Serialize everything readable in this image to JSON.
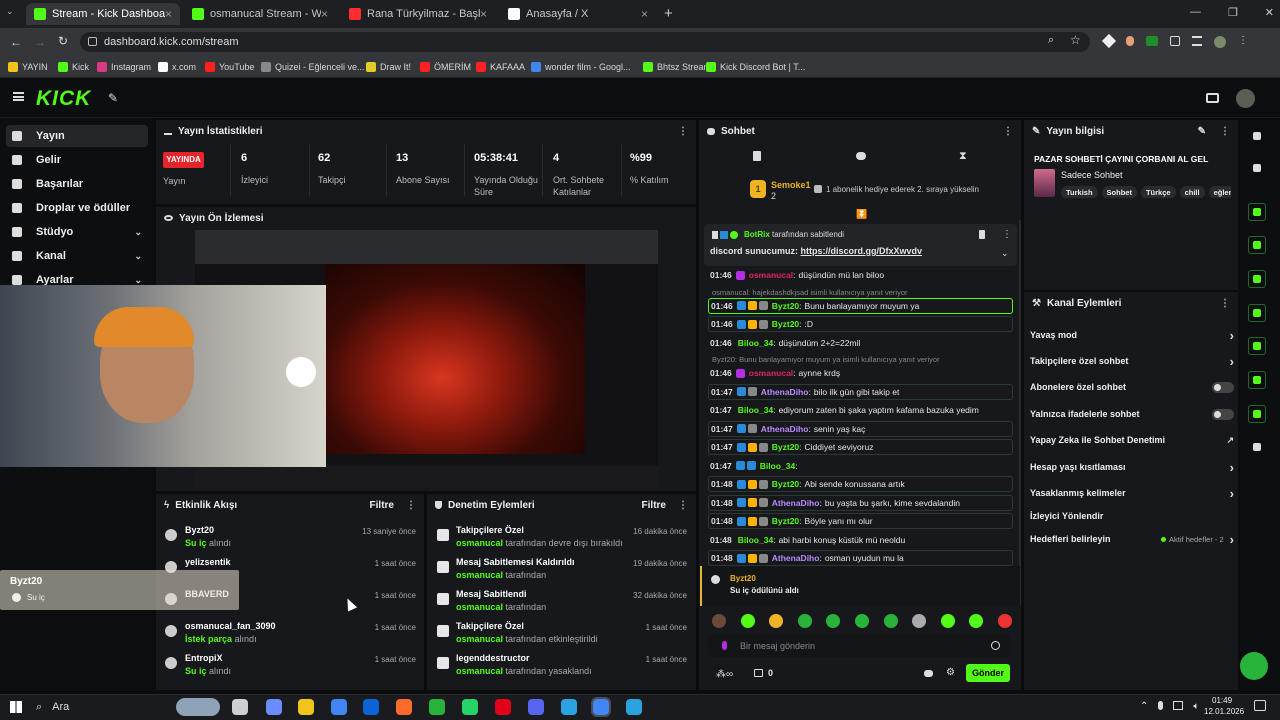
{
  "browser": {
    "tabs": [
      {
        "title": "Stream - Kick Dashboard",
        "color": "#53fc18"
      },
      {
        "title": "osmanucal Stream - Watch Live",
        "color": "#53fc18"
      },
      {
        "title": "Rana Türkyilmaz - Başka Hi",
        "color": "#ff2d2d"
      },
      {
        "title": "Anasayfa / X",
        "color": "#ffffff"
      }
    ],
    "url": "dashboard.kick.com/stream",
    "bookmarks": [
      "YAYIN",
      "Kick",
      "Instagram",
      "x.com",
      "YouTube",
      "Quizei - Eğlenceli ve...",
      "Draw It!",
      "ÖMERİM",
      "KAFAAA",
      "wonder film - Googl...",
      "Bhtsz Stream",
      "Kick Discord Bot | T..."
    ]
  },
  "kick": {
    "logo": "KICK",
    "sidebar": [
      {
        "label": "Yayın",
        "icon": "broadcast-icon",
        "chevron": false
      },
      {
        "label": "Gelir",
        "icon": "money-icon",
        "chevron": false
      },
      {
        "label": "Başarılar",
        "icon": "trophy-icon",
        "chevron": false
      },
      {
        "label": "Droplar ve ödüller",
        "icon": "gift-icon",
        "chevron": false
      },
      {
        "label": "Stüdyo",
        "icon": "video-icon",
        "chevron": true
      },
      {
        "label": "Kanal",
        "icon": "home-icon",
        "chevron": true
      },
      {
        "label": "Ayarlar",
        "icon": "gear-icon",
        "chevron": true
      }
    ]
  },
  "stats": {
    "title": "Yayın İstatistikleri",
    "live_badge": "YAYINDA",
    "live_label": "Yayın",
    "items": [
      {
        "value": "6",
        "label": "İzleyici"
      },
      {
        "value": "62",
        "label": "Takipçi"
      },
      {
        "value": "13",
        "label": "Abone Sayısı"
      },
      {
        "value": "05:38:41",
        "label": "Yayında Olduğu Süre"
      },
      {
        "value": "4",
        "label": "Ort. Sohbete Katılanlar"
      },
      {
        "value": "%99",
        "label": "% Katılım"
      }
    ]
  },
  "preview": {
    "title": "Yayın Ön İzlemesi"
  },
  "activity": {
    "title": "Etkinlik Akışı",
    "filter": "Filtre",
    "rows": [
      {
        "name": "Byzt20",
        "sub": "Su iç",
        "sub2": "alındı",
        "time": "13 saniye önce"
      },
      {
        "name": "yelizsentik",
        "sub": "",
        "sub2": "",
        "time": "1 saat önce"
      },
      {
        "name": "BBAVERD",
        "sub": "",
        "sub2": "",
        "time": "1 saat önce"
      },
      {
        "name": "osmanucal_fan_3090",
        "sub": "İstek parça",
        "sub2": "alındı",
        "time": "1 saat önce"
      },
      {
        "name": "EntropiX",
        "sub": "Su iç",
        "sub2": "alındı",
        "time": "1 saat önce"
      }
    ],
    "toast": {
      "name": "Byzt20",
      "sub": "Su iç"
    }
  },
  "moderation": {
    "title": "Denetim Eylemleri",
    "filter": "Filtre",
    "rows": [
      {
        "title": "Takipçilere Özel",
        "user": "osmanucal",
        "rest": "tarafından devre dışı bırakıldı",
        "time": "16 dakika önce",
        "icon": "heart-icon"
      },
      {
        "title": "Mesaj Sabitlemesi Kaldırıldı",
        "user": "osmanucal",
        "rest": "tarafından",
        "time": "19 dakika önce",
        "icon": "unpin-icon"
      },
      {
        "title": "Mesaj Sabitlendi",
        "user": "osmanucal",
        "rest": "tarafından",
        "time": "32 dakika önce",
        "icon": "pin-icon"
      },
      {
        "title": "Takipçilere Özel",
        "user": "osmanucal",
        "rest": "tarafından etkinleştirildi",
        "time": "1 saat önce",
        "icon": "heart-icon"
      },
      {
        "title": "legenddestructor",
        "user": "osmanucal",
        "rest": "tarafından yasaklandı",
        "time": "1 saat önce",
        "icon": "ban-icon"
      }
    ]
  },
  "chat": {
    "title": "Sohbet",
    "top_gifter": {
      "name": "Semoke1",
      "count": "2",
      "text": "1 abonelik hediye ederek 2. sıraya yükselin"
    },
    "pinned": {
      "by": "BotRix",
      "by_rest": "tarafından sabitlendi",
      "text": "discord sunucumuz:",
      "link": "https://discord.gg/DfxXwvdv"
    },
    "messages": [
      {
        "time": "01:46",
        "user": "osmanucal",
        "color": "#e0245e",
        "text": "düşündün mü lan biloo",
        "box": false,
        "badges": [
          "#b22ee0"
        ]
      },
      {
        "reply": "osmanucal: hajekdashdkjsad isimli kullanıcıya yanıt veriyor"
      },
      {
        "time": "01:46",
        "user": "Byzt20",
        "color": "#53fc18",
        "text": "Bunu banlayamıyor muyum ya",
        "box": true,
        "badges": [
          "#2b8ad6",
          "#ffb300",
          "#888888"
        ]
      },
      {
        "time": "01:46",
        "user": "Byzt20",
        "color": "#53fc18",
        "text": ":D",
        "box": true,
        "badges": [
          "#2b8ad6",
          "#ffb300",
          "#888888"
        ]
      },
      {
        "time": "01:46",
        "user": "Biloo_34",
        "color": "#53fc18",
        "text": "düşündüm 2+2=22mil",
        "box": false,
        "badges": []
      },
      {
        "reply": "Byzt20: Bunu banlayamıyor muyum ya isimli kullanıcıya yanıt veriyor"
      },
      {
        "time": "01:46",
        "user": "osmanucal",
        "color": "#e0245e",
        "text": "aynne krdş",
        "box": false,
        "badges": [
          "#b22ee0"
        ]
      },
      {
        "time": "01:47",
        "user": "AthenaDiho",
        "color": "#b98cff",
        "text": "bilo ilk gün gibi takip et",
        "box": true,
        "badges": [
          "#2b8ad6",
          "#888888"
        ]
      },
      {
        "time": "01:47",
        "user": "Biloo_34",
        "color": "#53fc18",
        "text": "ediyorum zaten bi şaka yaptım kafama bazuka yedim",
        "box": false,
        "badges": []
      },
      {
        "time": "01:47",
        "user": "AthenaDiho",
        "color": "#b98cff",
        "text": "senin yaş kaç",
        "box": true,
        "badges": [
          "#2b8ad6",
          "#888888"
        ]
      },
      {
        "time": "01:47",
        "user": "Byzt20",
        "color": "#53fc18",
        "text": "Ciddiyet seviyoruz",
        "box": true,
        "badges": [
          "#2b8ad6",
          "#ffb300",
          "#888888"
        ]
      },
      {
        "time": "01:47",
        "user": "Biloo_34",
        "color": "#53fc18",
        "text": "",
        "box": false,
        "badges": [
          "#2b8ad6",
          "#2b8ad6"
        ]
      },
      {
        "time": "01:48",
        "user": "Byzt20",
        "color": "#53fc18",
        "text": "Abi sende konussana artık",
        "box": true,
        "badges": [
          "#2b8ad6",
          "#ffb300",
          "#888888"
        ]
      },
      {
        "time": "01:48",
        "user": "AthenaDiho",
        "color": "#b98cff",
        "text": "bu yaşta bu şarkı, kime sevdalandin",
        "box": true,
        "badges": [
          "#2b8ad6",
          "#ffb300",
          "#888888"
        ]
      },
      {
        "time": "01:48",
        "user": "Byzt20",
        "color": "#53fc18",
        "text": "Böyle yanı mı olur",
        "box": true,
        "badges": [
          "#2b8ad6",
          "#ffb300",
          "#888888"
        ]
      },
      {
        "time": "01:48",
        "user": "Biloo_34",
        "color": "#53fc18",
        "text": "abi harbi konuş küstük mü neoldu",
        "box": false,
        "badges": []
      },
      {
        "time": "01:48",
        "user": "AthenaDiho",
        "color": "#b98cff",
        "text": "osman uyudun mu la",
        "box": true,
        "badges": [
          "#2b8ad6",
          "#ffb300",
          "#888888"
        ]
      }
    ],
    "reward": {
      "user": "Byzt20",
      "text": "Su iç ödülünü aldı"
    },
    "input_placeholder": "Bir mesaj gönderin",
    "points": "0",
    "send": "Gönder"
  },
  "info": {
    "title": "Yayın bilgisi",
    "stream_title": "PAZAR SOHBETİ ÇAYINI ÇORBANI AL GEL",
    "category": "Sadece Sohbet",
    "tags": [
      "Turkish",
      "Sohbet",
      "Türkçe",
      "chill",
      "eğlen"
    ]
  },
  "channel_actions": {
    "title": "Kanal Eylemleri",
    "items": [
      {
        "label": "Yavaş mod",
        "ctrl": "chevron"
      },
      {
        "label": "Takipçilere özel sohbet",
        "ctrl": "chevron"
      },
      {
        "label": "Abonelere özel sohbet",
        "ctrl": "toggle"
      },
      {
        "label": "Yalnızca ifadelerle sohbet",
        "ctrl": "toggle"
      },
      {
        "label": "Yapay Zeka ile Sohbet Denetimi",
        "ctrl": "ext"
      },
      {
        "label": "Hesap yaşı kısıtlaması",
        "ctrl": "chevron"
      },
      {
        "label": "Yasaklanmış kelimeler",
        "ctrl": "chevron"
      },
      {
        "label": "İzleyici Yönlendir",
        "ctrl": "none"
      },
      {
        "label": "Hedefleri belirleyin",
        "ctrl": "chevron"
      }
    ],
    "goals_status": "Aktif hedefler - 2"
  },
  "taskbar": {
    "search": "Ara",
    "time": "01:49",
    "date": "12.01.2026"
  },
  "colors": {
    "accent": "#53fc18",
    "live": "#e5242b",
    "panel": "#17181b",
    "bg": "#0b0c0e"
  }
}
